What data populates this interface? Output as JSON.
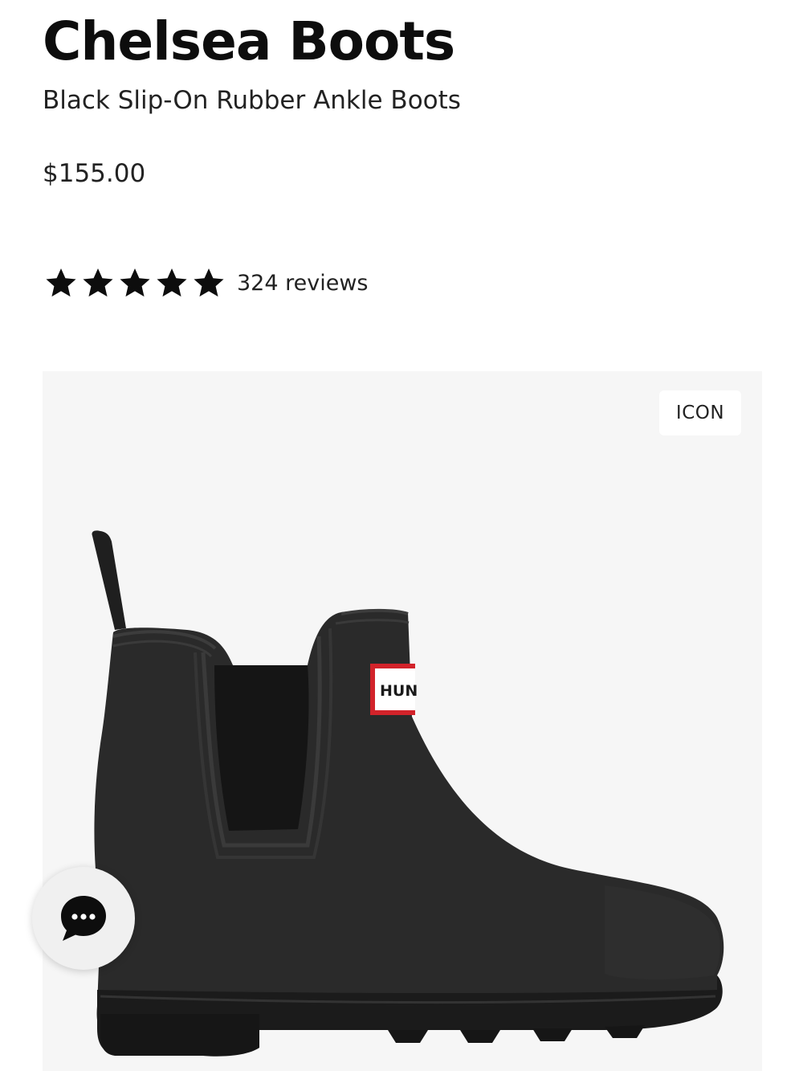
{
  "product": {
    "title": "Chelsea Boots",
    "subtitle": "Black Slip-On Rubber Ankle Boots",
    "price": "$155.00"
  },
  "rating": {
    "stars": 5,
    "max_stars": 5,
    "review_count_label": "324 reviews"
  },
  "gallery": {
    "badge_label": "ICON",
    "logo_label_text": "HUNTER"
  },
  "chat": {
    "icon": "chat-bubble-icon"
  },
  "colors": {
    "text": "#0d0d0d",
    "panel_background": "#f6f6f6",
    "boot_rubber": "#2a2a2a",
    "logo_red": "#d2232a"
  }
}
